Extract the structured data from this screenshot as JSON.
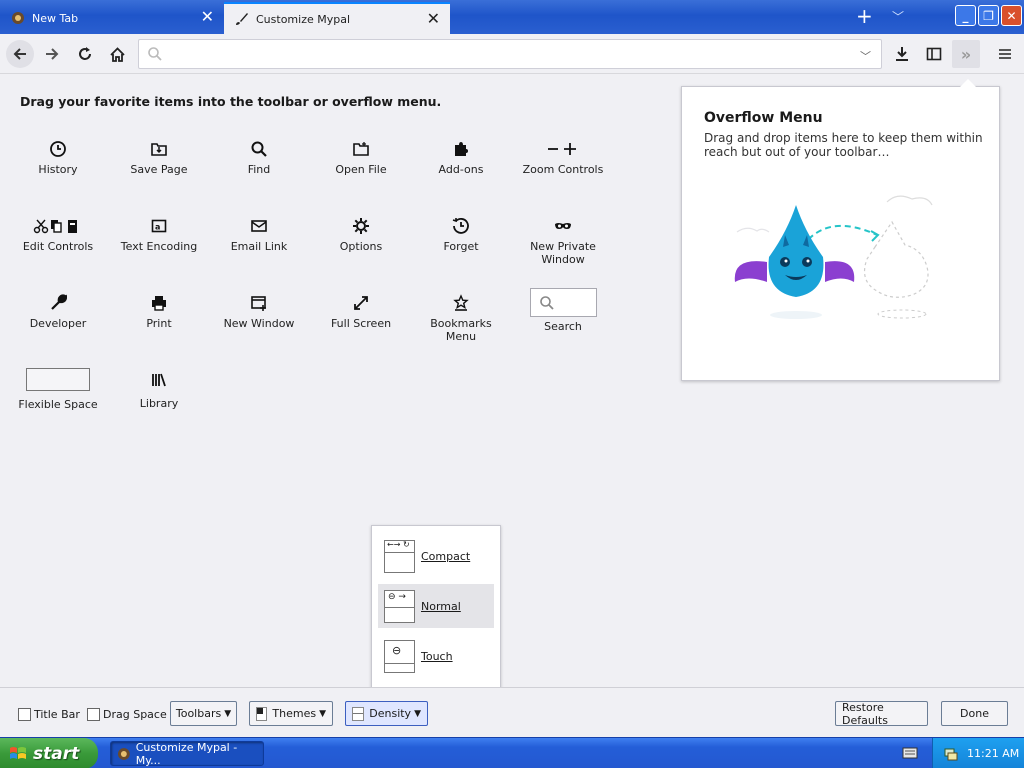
{
  "window": {
    "tabs": [
      {
        "label": "New Tab"
      },
      {
        "label": "Customize Mypal"
      }
    ]
  },
  "navbar": {
    "url_value": ""
  },
  "palette": {
    "heading": "Drag your favorite items into the toolbar or overflow menu.",
    "items": [
      {
        "label": "History",
        "icon": "clock-icon"
      },
      {
        "label": "Save Page",
        "icon": "save-page-icon"
      },
      {
        "label": "Find",
        "icon": "magnifier-icon"
      },
      {
        "label": "Open File",
        "icon": "folder-icon"
      },
      {
        "label": "Add-ons",
        "icon": "puzzle-icon"
      },
      {
        "label": "Zoom Controls",
        "icon": "zoom-icon"
      },
      {
        "label": "Edit Controls",
        "icon": "scissors-copy-paste-icon"
      },
      {
        "label": "Text Encoding",
        "icon": "text-encoding-icon"
      },
      {
        "label": "Email Link",
        "icon": "envelope-icon"
      },
      {
        "label": "Options",
        "icon": "gear-icon"
      },
      {
        "label": "Forget",
        "icon": "forget-clock-icon"
      },
      {
        "label": "New Private Window",
        "icon": "mask-icon"
      },
      {
        "label": "Developer",
        "icon": "wrench-icon"
      },
      {
        "label": "Print",
        "icon": "printer-icon"
      },
      {
        "label": "New Window",
        "icon": "new-window-icon"
      },
      {
        "label": "Full Screen",
        "icon": "fullscreen-icon"
      },
      {
        "label": "Bookmarks Menu",
        "icon": "star-tray-icon"
      },
      {
        "label": "Search",
        "icon": "search-box"
      },
      {
        "label": "Flexible Space",
        "icon": "flexible-space-box"
      },
      {
        "label": "Library",
        "icon": "library-icon"
      }
    ]
  },
  "overflow_panel": {
    "title": "Overflow Menu",
    "description": "Drag and drop items here to keep them within reach but out of your toolbar…"
  },
  "density": {
    "options": [
      {
        "label": "Compact",
        "selected": false
      },
      {
        "label": "Normal",
        "selected": true
      },
      {
        "label": "Touch",
        "selected": false
      }
    ]
  },
  "footer": {
    "title_bar_label": "Title Bar",
    "drag_space_label": "Drag Space",
    "toolbars_label": "Toolbars",
    "themes_label": "Themes",
    "density_label": "Density",
    "restore_label": "Restore Defaults",
    "done_label": "Done"
  },
  "taskbar": {
    "start_label": "start",
    "task_label": "Customize Mypal - My...",
    "clock": "11:21 AM"
  },
  "colors": {
    "accent": "#0a84ff",
    "titlebar": "#2a5fd0",
    "start": "#3a9a3a",
    "mascot": "#1aa3d8"
  }
}
